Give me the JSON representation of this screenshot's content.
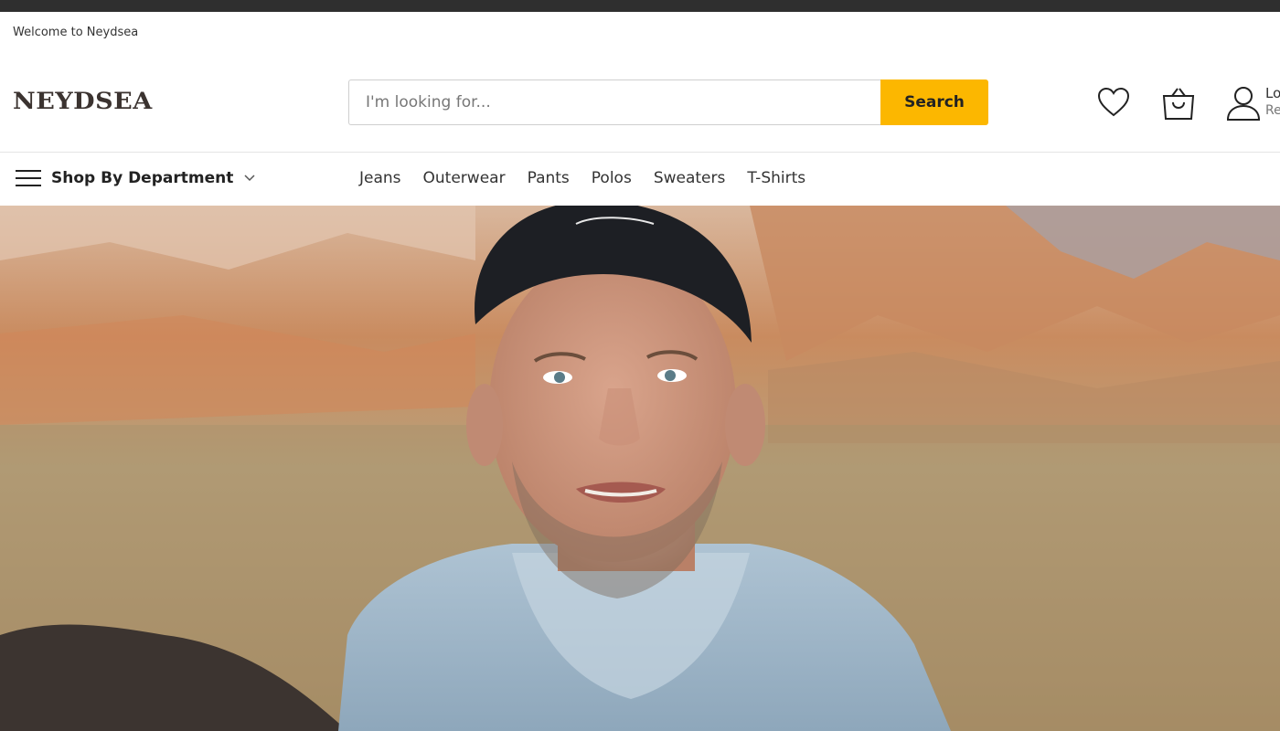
{
  "header": {
    "welcome": "Welcome to Neydsea",
    "logo": "NEYDSEA",
    "search": {
      "placeholder": "I'm looking for...",
      "button": "Search"
    },
    "account": {
      "line1": "Lo",
      "line2": "Re"
    },
    "icons": {
      "wishlist": "heart-icon",
      "cart": "shopping-bag-icon",
      "account": "user-icon"
    }
  },
  "nav": {
    "department": "Shop By Department",
    "items": [
      "Jeans",
      "Outerwear",
      "Pants",
      "Polos",
      "Sweaters",
      "T-Shirts"
    ]
  },
  "colors": {
    "accent": "#fcb700",
    "topbar": "#2f2f2f"
  }
}
